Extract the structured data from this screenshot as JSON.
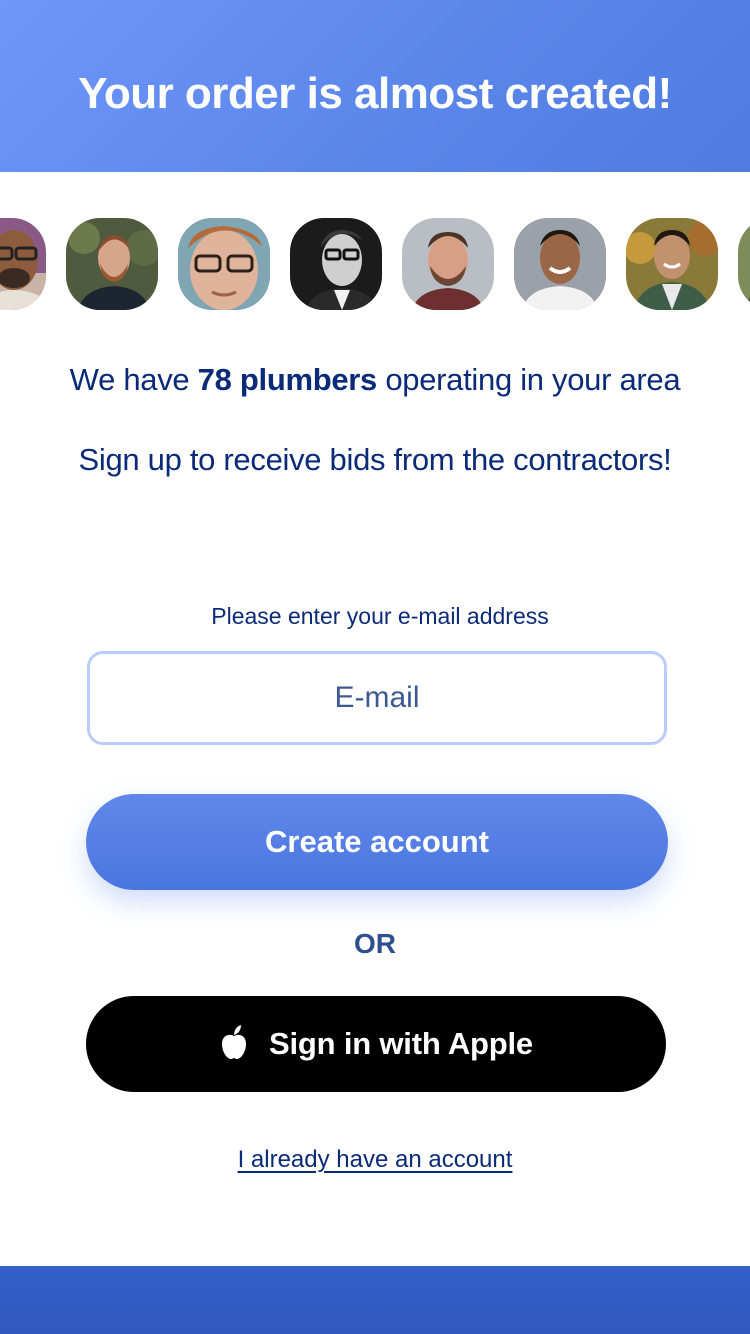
{
  "header": {
    "title": "Your order is almost created!"
  },
  "avatars": [
    {
      "label": "contractor-photo-1"
    },
    {
      "label": "contractor-photo-2"
    },
    {
      "label": "contractor-photo-3"
    },
    {
      "label": "contractor-photo-4"
    },
    {
      "label": "contractor-photo-5"
    },
    {
      "label": "contractor-photo-6"
    },
    {
      "label": "contractor-photo-7"
    },
    {
      "label": "contractor-photo-8"
    }
  ],
  "info": {
    "prefix": "We have ",
    "highlight": "78 plumbers",
    "suffix": " operating in your area",
    "subtitle": "Sign up to receive bids from the contractors!"
  },
  "form": {
    "email_label": "Please enter your e-mail address",
    "email_placeholder": "E-mail",
    "create_label": "Create account",
    "or_label": "OR",
    "apple_label": "Sign in with Apple",
    "login_label": "I already have an account"
  },
  "colors": {
    "header": "#5b86ea",
    "accent": "#4a76e0",
    "text": "#0b2a78",
    "footer": "#2f58c0"
  }
}
